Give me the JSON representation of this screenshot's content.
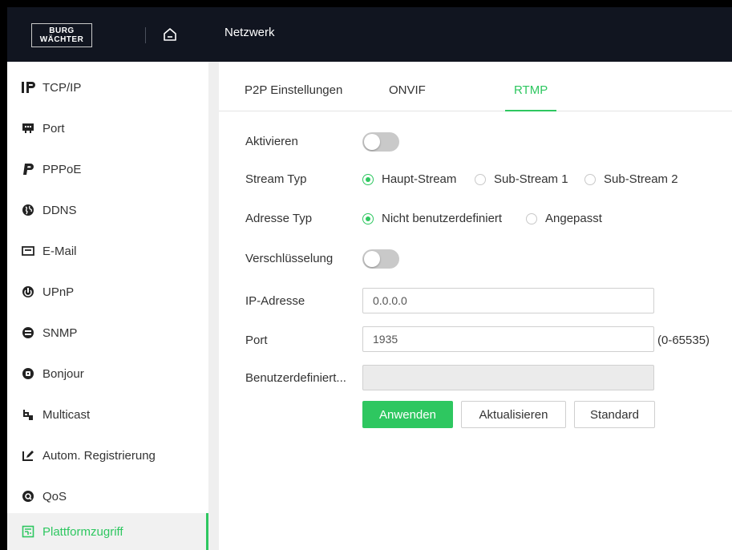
{
  "brand": {
    "line1": "BURG",
    "line2": "WÄCHTER"
  },
  "header": {
    "title": "Netzwerk"
  },
  "sidebar": {
    "items": [
      {
        "label": "TCP/IP",
        "icon": "ip-icon"
      },
      {
        "label": "Port",
        "icon": "port-icon"
      },
      {
        "label": "PPPoE",
        "icon": "pppoe-icon"
      },
      {
        "label": "DDNS",
        "icon": "ddns-icon"
      },
      {
        "label": "E-Mail",
        "icon": "email-icon"
      },
      {
        "label": "UPnP",
        "icon": "upnp-icon"
      },
      {
        "label": "SNMP",
        "icon": "snmp-icon"
      },
      {
        "label": "Bonjour",
        "icon": "bonjour-icon"
      },
      {
        "label": "Multicast",
        "icon": "multicast-icon"
      },
      {
        "label": "Autom. Registrierung",
        "icon": "auto-register-icon"
      },
      {
        "label": "QoS",
        "icon": "qos-icon"
      },
      {
        "label": "Plattformzugriff",
        "icon": "platform-access-icon",
        "active": true
      }
    ]
  },
  "tabs": [
    {
      "label": "P2P Einstellungen"
    },
    {
      "label": "ONVIF"
    },
    {
      "label": "RTMP",
      "active": true
    }
  ],
  "form": {
    "enable": {
      "label": "Aktivieren",
      "value": false
    },
    "stream_type": {
      "label": "Stream Typ",
      "options": [
        "Haupt-Stream",
        "Sub-Stream 1",
        "Sub-Stream 2"
      ],
      "selected": "Haupt-Stream"
    },
    "address_type": {
      "label": "Adresse Typ",
      "options": [
        "Nicht benutzerdefiniert",
        "Angepasst"
      ],
      "selected": "Nicht benutzerdefiniert"
    },
    "encryption": {
      "label": "Verschlüsselung",
      "value": false
    },
    "ip_address": {
      "label": "IP-Adresse",
      "value": "0.0.0.0"
    },
    "port": {
      "label": "Port",
      "value": "1935",
      "range": "(0-65535)"
    },
    "custom": {
      "label": "Benutzerdefiniert...",
      "value": ""
    }
  },
  "buttons": {
    "apply": "Anwenden",
    "refresh": "Aktualisieren",
    "default": "Standard"
  },
  "colors": {
    "accent": "#2ec760",
    "header_bg": "#111520",
    "toggle_off": "#c9c9c9"
  }
}
